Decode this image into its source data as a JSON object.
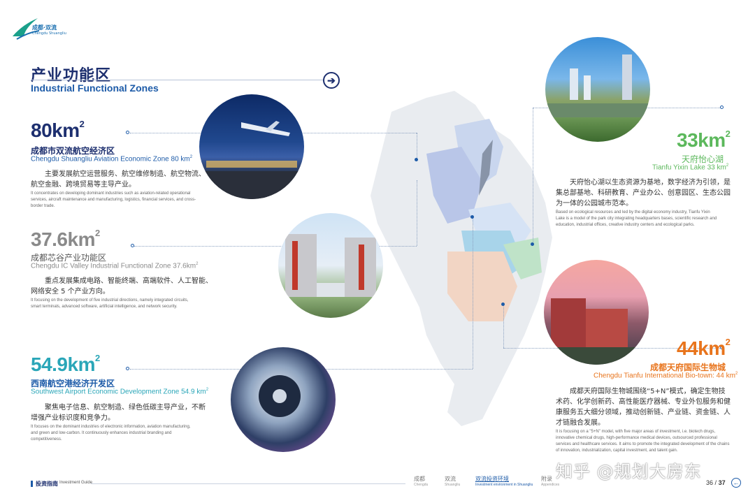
{
  "logo": {
    "brand": "成都·双流",
    "sub": "Chengdu Shuangliu"
  },
  "header": {
    "title_cn": "产业功能区",
    "title_en": "Industrial Functional Zones"
  },
  "zones": [
    {
      "area_num": "80km",
      "area_exp": "2",
      "name_cn": "成都市双流航空经济区",
      "name_en": "Chengdu Shuangliu Aviation Economic Zone 80 km",
      "name_en_exp": "2",
      "desc_cn_1": "主要发展航空运营服务、航空维修制造、航空物流、",
      "desc_cn_2": "航空金融、跨境贸易等主导产业。",
      "desc_en_1": "It concentrates on developing dominant industries such as aviation-related operational",
      "desc_en_2": "services, aircraft maintenance and manufacturing, logistics, financial services, and cross-",
      "desc_en_3": "border trade.",
      "color": "#1d2f6f"
    },
    {
      "area_num": "37.6km",
      "area_exp": "2",
      "name_cn": "成都芯谷产业功能区",
      "name_en": "Chengdu IC Valley Industrial Functional Zone 37.6km",
      "name_en_exp": "2",
      "desc_cn_1": "重点发展集成电路、智能终端、高端软件、人工智能、",
      "desc_cn_2": "网络安全 5 个产业方向。",
      "desc_en_1": "It focusing on the development of five industrial directions, namely integrated circuits,",
      "desc_en_2": "smart terminals, advanced software, artificial intelligence, and network security.",
      "color": "#8a8a8a"
    },
    {
      "area_num": "54.9km",
      "area_exp": "2",
      "name_cn": "西南航空港经济开发区",
      "name_en": "Southwest Airport Economic Development Zone 54.9 km",
      "name_en_exp": "2",
      "desc_cn_1": "聚焦电子信息、航空制造、绿色低碳主导产业，不断",
      "desc_cn_2": "增强产业标识度和竞争力。",
      "desc_en_1": "It focuses on the dominant industries of electronic information, aviation manufacturing,",
      "desc_en_2": "and green and low-carbon. It continuously enhances industrial branding and",
      "desc_en_3": "competitiveness.",
      "color": "#2aa6b8"
    },
    {
      "area_num": "33km",
      "area_exp": "2",
      "name_cn": "天府怡心湖",
      "name_en": "Tianfu Yixin Lake 33 km",
      "name_en_exp": "2",
      "desc_cn_1": "天府怡心湖以生态资源为基地，数字经济为引领，是",
      "desc_cn_2": "集总部基地、科研教育、产业办公、创意园区、生态公园",
      "desc_cn_3": "为一体的公园城市范本。",
      "desc_en_1": "Based on ecological resources and led by the digital economy industry, Tianfu Yixin",
      "desc_en_2": "Lake is a model of the park city integrating headquarters bases, scientific research and",
      "desc_en_3": "education, industrial offices, creative industry centers and ecological parks.",
      "color": "#5cb85c"
    },
    {
      "area_num": "44km",
      "area_exp": "2",
      "name_cn": "成都天府国际生物城",
      "name_en": "Chengdu Tianfu International Bio-town: 44 km",
      "name_en_exp": "2",
      "desc_cn_1": "成都天府国际生物城围绕“5+N”模式，确定生物技",
      "desc_cn_2": "术药、化学创新药、高性能医疗器械、专业外包服务和健",
      "desc_cn_3": "康服务五大细分领域，推动创新链、产业链、资金链、人",
      "desc_cn_4": "才链融合发展。",
      "desc_en_1": "It is focusing on a \"5+N\" model, with five major areas of investment, i.e. biotech drugs,",
      "desc_en_2": "innovative chemical drugs, high-performance medical devices, outsourced professional",
      "desc_en_3": "services and healthcare services. It aims to promote the integrated development of the chains",
      "desc_en_4": "of innovation, industrialization, capital investment, and talent gain.",
      "color": "#e8741c"
    }
  ],
  "footer": {
    "label_cn": "投资指南",
    "label_en": "Investment Guide",
    "nav": [
      {
        "cn": "成都",
        "en": "Chengdu"
      },
      {
        "cn": "双流",
        "en": "Shuangliu"
      },
      {
        "cn": "双流投资环境",
        "en": "Investment environment in Shuangliu"
      },
      {
        "cn": "附录",
        "en": "Appendices"
      }
    ],
    "page_left": "36",
    "page_sep": "/",
    "page_right": "37"
  },
  "watermark": "知乎 @规划大房东",
  "colors": {
    "navy": "#1d2f6f",
    "blue": "#1d5ba8",
    "teal": "#2aa6b8",
    "green": "#5cb85c",
    "orange": "#e8741c"
  }
}
